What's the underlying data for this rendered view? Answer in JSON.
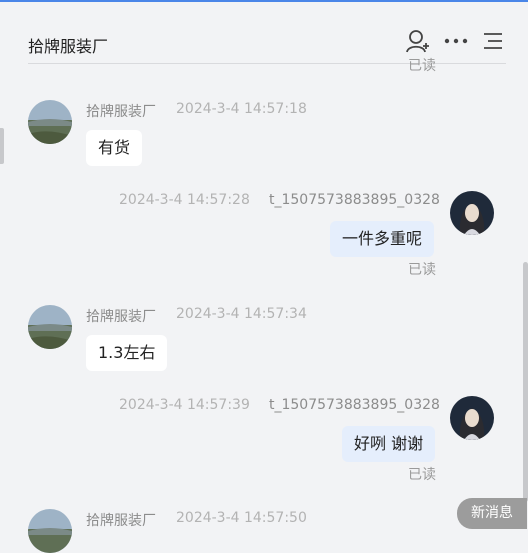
{
  "header": {
    "title": "拾牌服装厂",
    "icons": [
      "add-user-icon",
      "more-icon",
      "menu-icon"
    ]
  },
  "read_label": "已读",
  "messages": [
    {
      "sender": "拾牌服装厂",
      "time": "2024-3-4 14:57:18",
      "text": "有货",
      "direction": "in"
    },
    {
      "sender": "t_1507573883895_0328",
      "time": "2024-3-4 14:57:28",
      "text": "一件多重呢",
      "direction": "out",
      "status": "已读"
    },
    {
      "sender": "拾牌服装厂",
      "time": "2024-3-4 14:57:34",
      "text": "1.3左右",
      "direction": "in"
    },
    {
      "sender": "t_1507573883895_0328",
      "time": "2024-3-4 14:57:39",
      "text": "好咧 谢谢",
      "direction": "out",
      "status": "已读"
    },
    {
      "sender": "拾牌服装厂",
      "time": "2024-3-4 14:57:50",
      "text": "",
      "direction": "in"
    }
  ],
  "new_message_button": "新消息"
}
